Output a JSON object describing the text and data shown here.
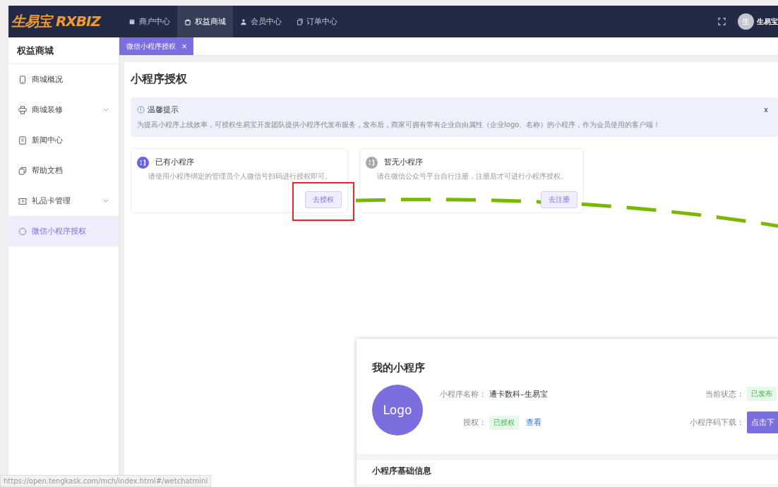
{
  "top_bar": {
    "logo": "生易宝 RXBIZ",
    "nav": [
      {
        "label": "商户中心",
        "selected": false
      },
      {
        "label": "权益商城",
        "selected": true
      },
      {
        "label": "会员中心",
        "selected": false
      },
      {
        "label": "订单中心",
        "selected": false
      }
    ],
    "avatar": "生",
    "user_name": "生易宝"
  },
  "sidebar": {
    "title": "权益商城",
    "items": [
      {
        "label": "商城概况",
        "expandable": false,
        "selected": false
      },
      {
        "label": "商城装修",
        "expandable": true,
        "selected": false
      },
      {
        "label": "新闻中心",
        "expandable": false,
        "selected": false
      },
      {
        "label": "帮助文档",
        "expandable": false,
        "selected": false
      },
      {
        "label": "礼品卡管理",
        "expandable": true,
        "selected": false
      },
      {
        "label": "微信小程序授权",
        "expandable": false,
        "selected": true
      }
    ]
  },
  "tabs": [
    {
      "label": "微信小程序授权",
      "selected": true,
      "close": "×"
    }
  ],
  "page": {
    "title": "小程序授权",
    "notice": {
      "title": "温馨提示",
      "text": "为提高小程序上线效率，可授权生易宝开发团队提供小程序代发布服务，发布后，商家可拥有带有企业自由属性（企业logo、名称）的小程序，作为会员使用的客户端！",
      "close": "x"
    },
    "cards": [
      {
        "title": "已有小程序",
        "description": "请使用小程序绑定的管理员个人微信号扫码进行授权即可。",
        "button": "去授权",
        "active": true
      },
      {
        "title": "暂无小程序",
        "description": "请在微信公众号平台自行注册，注册后才可进行小程序授权。",
        "button": "去注册",
        "active": false
      }
    ]
  },
  "inset": {
    "title": "我的小程序",
    "logo": "Logo",
    "name_label": "小程序名称：",
    "name_value": "通卡数科–生易宝",
    "status_label": "当前状态：",
    "status_tag": "已发布",
    "auth_label": "授权：",
    "auth_tag": "已授权",
    "auth_link": "查看",
    "download_label": "小程序码下载：",
    "download_button": "点击下",
    "next_section": "小程序基础信息"
  },
  "status_bar": {
    "url": "https://open.tengkask.com/mch/index.html#/wetchatmini"
  }
}
